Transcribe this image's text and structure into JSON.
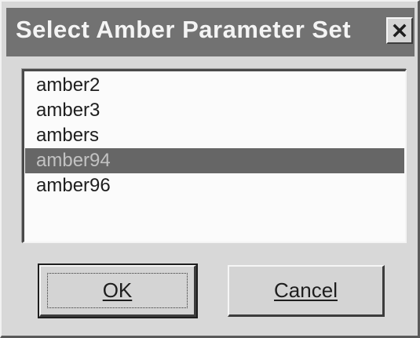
{
  "dialog": {
    "title": "Select Amber Parameter Set",
    "close_label": "close-icon"
  },
  "list": {
    "items": [
      "amber2",
      "amber3",
      "ambers",
      "amber94",
      "amber96"
    ],
    "selected_index": 3
  },
  "buttons": {
    "ok_label": "OK",
    "cancel_label": "Cancel"
  },
  "colors": {
    "title_bar": "#727272",
    "selection": "#666666",
    "dialog_face": "#d8d8d8"
  }
}
